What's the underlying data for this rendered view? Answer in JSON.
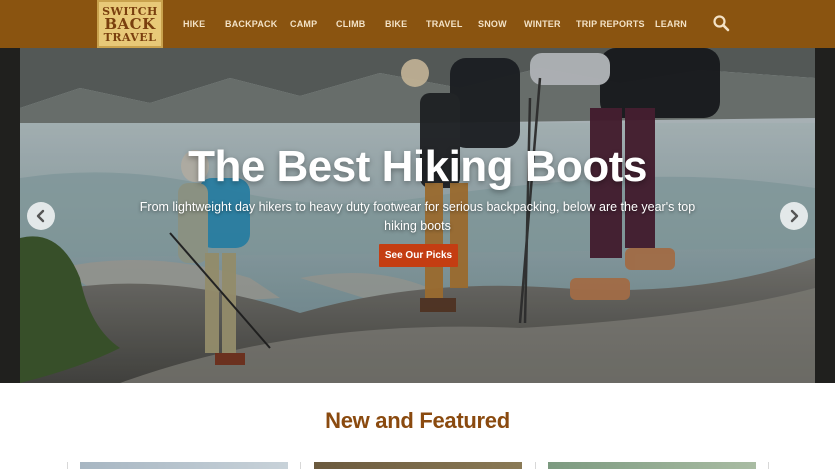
{
  "site": {
    "logo": {
      "line1": "SWITCH",
      "line2": "BACK",
      "line3": "TRAVEL"
    }
  },
  "nav": {
    "items": [
      {
        "label": "HIKE"
      },
      {
        "label": "BACKPACK"
      },
      {
        "label": "CAMP"
      },
      {
        "label": "CLIMB"
      },
      {
        "label": "BIKE"
      },
      {
        "label": "TRAVEL"
      },
      {
        "label": "SNOW"
      },
      {
        "label": "WINTER"
      },
      {
        "label": "TRIP REPORTS"
      },
      {
        "label": "LEARN"
      }
    ],
    "search_icon": "search-icon"
  },
  "hero": {
    "title": "The Best Hiking Boots",
    "subtitle": "From lightweight day hikers to heavy duty footwear for serious backpacking, below are the year's top hiking boots",
    "cta_label": "See Our Picks",
    "prev_icon": "chevron-left-icon",
    "next_icon": "chevron-right-icon"
  },
  "featured": {
    "heading": "New and Featured"
  },
  "colors": {
    "header_bg": "#8a5410",
    "nav_text": "#f3e2c6",
    "logo_bg": "#e8c978",
    "cta_bg": "#c43d12",
    "section_heading": "#8a4a0f"
  }
}
